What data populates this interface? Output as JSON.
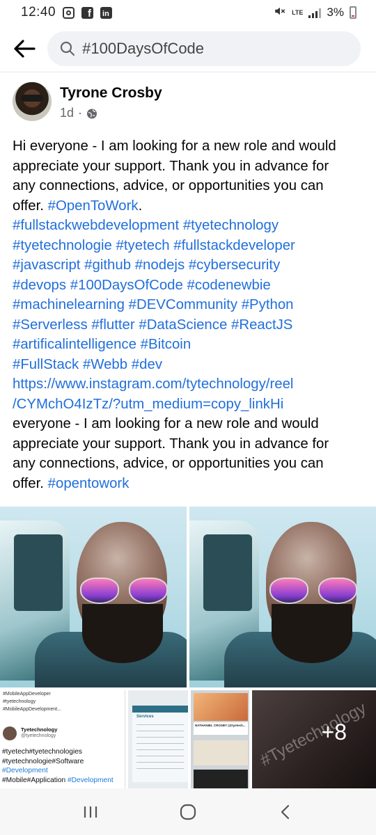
{
  "status_bar": {
    "time": "12:40",
    "network": "LTE",
    "battery": "3%",
    "icons": [
      "instagram-icon",
      "facebook-icon",
      "linkedin-icon",
      "mute-icon",
      "signal-icon",
      "battery-icon"
    ]
  },
  "search": {
    "query": "#100DaysOfCode"
  },
  "post": {
    "author": "Tyrone Crosby",
    "time": "1d",
    "audience_icon": "globe-icon",
    "text_lines": [
      [
        {
          "t": "Hi everyone - I am looking for a new role and would"
        }
      ],
      [
        {
          "t": "appreciate your support. Thank you in advance for"
        }
      ],
      [
        {
          "t": "any connections, advice, or opportunities you can"
        }
      ],
      [
        {
          "t": "offer. "
        },
        {
          "t": "#OpenToWork",
          "link": true
        },
        {
          "t": "."
        }
      ],
      [
        {
          "t": "#fullstackwebdevelopment",
          "link": true
        },
        {
          "t": " "
        },
        {
          "t": "#tyetechnology",
          "link": true
        }
      ],
      [
        {
          "t": "#tyetechnologie",
          "link": true
        },
        {
          "t": " "
        },
        {
          "t": "#tyetech",
          "link": true
        },
        {
          "t": " "
        },
        {
          "t": "#fullstackdeveloper",
          "link": true
        }
      ],
      [
        {
          "t": "#javascript",
          "link": true
        },
        {
          "t": " "
        },
        {
          "t": "#github",
          "link": true
        },
        {
          "t": " "
        },
        {
          "t": "#nodejs",
          "link": true
        },
        {
          "t": " "
        },
        {
          "t": "#cybersecurity",
          "link": true
        }
      ],
      [
        {
          "t": "#devops",
          "link": true
        },
        {
          "t": " "
        },
        {
          "t": "#100DaysOfCode",
          "link": true
        },
        {
          "t": " "
        },
        {
          "t": "#codenewbie",
          "link": true
        }
      ],
      [
        {
          "t": "#machinelearning",
          "link": true
        },
        {
          "t": " "
        },
        {
          "t": "#DEVCommunity",
          "link": true
        },
        {
          "t": " "
        },
        {
          "t": "#Python",
          "link": true
        }
      ],
      [
        {
          "t": "#Serverless",
          "link": true
        },
        {
          "t": " "
        },
        {
          "t": "#flutter",
          "link": true
        },
        {
          "t": " "
        },
        {
          "t": "#DataScience",
          "link": true
        },
        {
          "t": " "
        },
        {
          "t": "#ReactJS",
          "link": true
        }
      ],
      [
        {
          "t": "#artificalintelligence",
          "link": true
        },
        {
          "t": " "
        },
        {
          "t": "#Bitcoin",
          "link": true
        }
      ],
      [
        {
          "t": "#FullStack",
          "link": true
        },
        {
          "t": " "
        },
        {
          "t": "#Webb",
          "link": true
        },
        {
          "t": " "
        },
        {
          "t": "#dev",
          "link": true
        }
      ],
      [
        {
          "t": "https://www.instagram.com/tytechnology/reel",
          "link": true
        }
      ],
      [
        {
          "t": "/CYMchO4IzTz/?utm_medium=copy_linkHi",
          "link": true
        }
      ],
      [
        {
          "t": "everyone - I am looking for a new role and would"
        }
      ],
      [
        {
          "t": "appreciate your support. Thank you in advance for"
        }
      ],
      [
        {
          "t": "any connections, advice, or opportunities you can"
        }
      ],
      [
        {
          "t": "offer. "
        },
        {
          "t": "#opentowork",
          "link": true
        }
      ]
    ]
  },
  "photos": {
    "tweet": {
      "top_lines": [
        "#MobileAppDeveloper",
        "#tyetechnology",
        "#MobileAppDevelopment..."
      ],
      "name": "Tyetechnology",
      "handle": "@tyetechnology",
      "body_lines": [
        [
          {
            "t": "#tyetech#tyetechnologies"
          }
        ],
        [
          {
            "t": "#tyetechnologie#Software"
          }
        ],
        [
          {
            "t": "#Development",
            "blue": true
          }
        ],
        [
          {
            "t": "#Mobile#Application "
          },
          {
            "t": "#Development",
            "blue": true
          }
        ]
      ]
    },
    "doc_title": "Services",
    "collage_caption": "NATHANIEL CROSBY (@tyetech...",
    "more_count": "+8",
    "watermark": "#Tyetechnology"
  },
  "nav": {
    "icons": [
      "recents-icon",
      "home-icon",
      "back-icon"
    ]
  },
  "colors": {
    "link": "#216fdb",
    "text": "#050505",
    "meta": "#65676b",
    "search_bg": "#f0f2f5"
  }
}
